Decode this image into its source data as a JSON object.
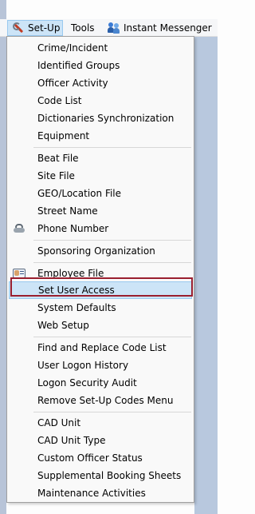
{
  "menubar": {
    "setup_label": "Set-Up",
    "tools_label": "Tools",
    "im_label": "Instant Messenger"
  },
  "menu": {
    "items": [
      "Crime/Incident",
      "Identified Groups",
      "Officer Activity",
      "Code List",
      "Dictionaries Synchronization",
      "Equipment",
      "Beat File",
      "Site File",
      "GEO/Location File",
      "Street Name",
      "Phone Number",
      "Sponsoring Organization",
      "Employee File",
      "Set User Access",
      "System Defaults",
      "Web Setup",
      "Find and Replace Code List",
      "User Logon History",
      "Logon Security Audit",
      "Remove Set-Up  Codes Menu",
      "CAD Unit",
      "CAD Unit Type",
      "Custom Officer Status",
      "Supplemental Booking Sheets",
      "Maintenance Activities"
    ]
  },
  "icons": {
    "setup": "wrench-icon",
    "im": "users-icon",
    "phone": "telephone-icon",
    "employee": "id-card-icon"
  },
  "colors": {
    "highlight_bg": "#cce4f7",
    "highlight_outline": "#9a1f2f",
    "app_background": "#b8c8de"
  }
}
